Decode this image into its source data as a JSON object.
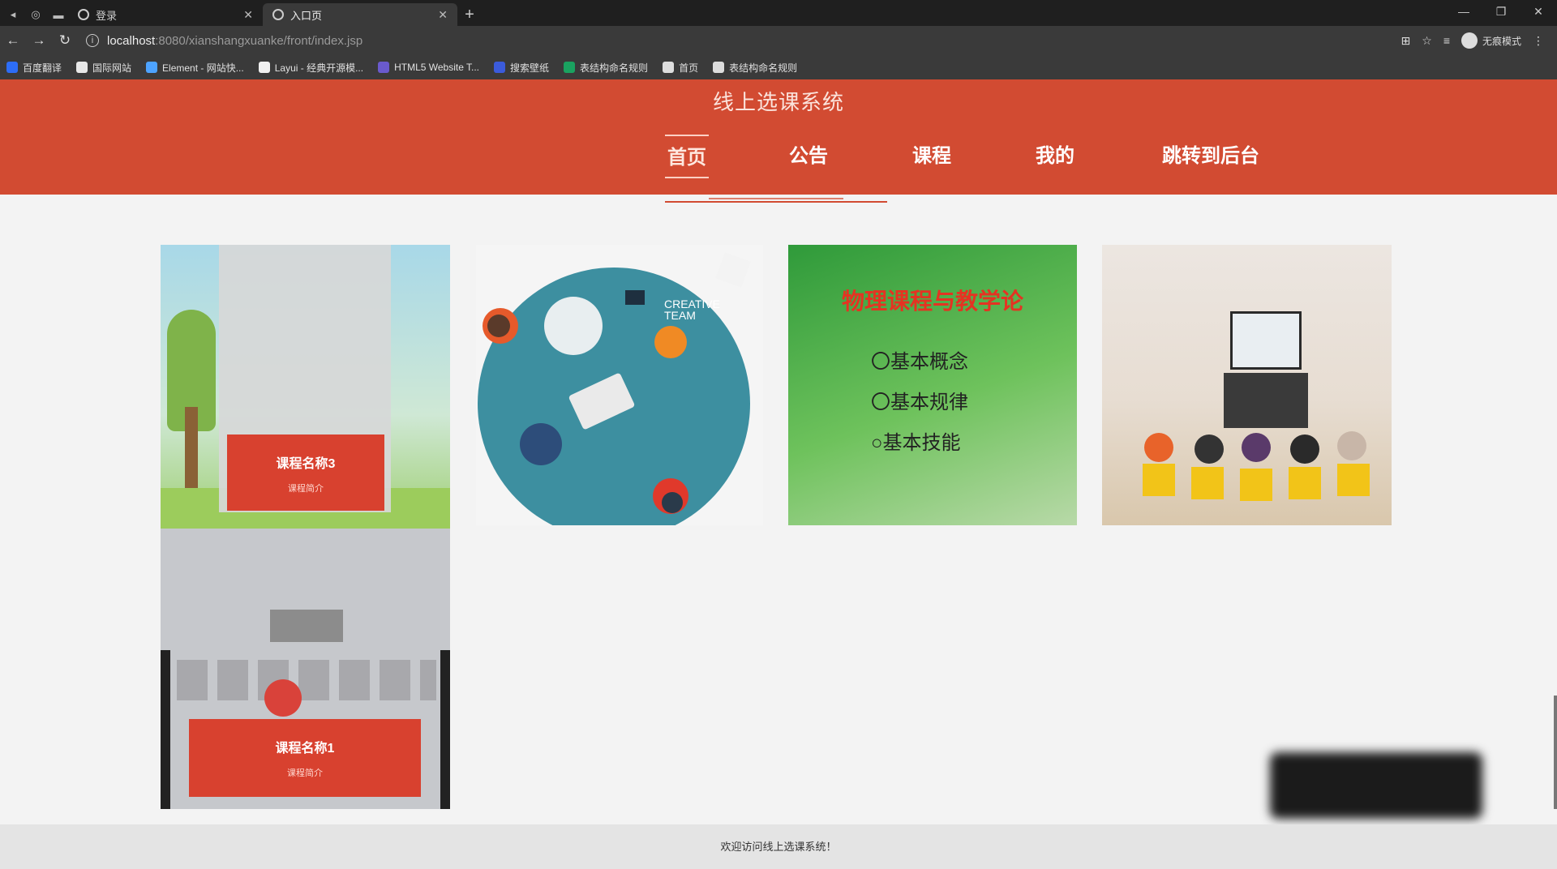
{
  "browser": {
    "tabs": [
      {
        "title": "登录"
      },
      {
        "title": "入口页"
      }
    ],
    "url_host": "localhost",
    "url_path": ":8080/xianshangxuanke/front/index.jsp",
    "profile_label": "无痕模式",
    "bookmarks": [
      {
        "label": "百度翻译",
        "color": "#2d6df6"
      },
      {
        "label": "国际网站",
        "color": "#e8e8e8"
      },
      {
        "label": "Element - 网站快...",
        "color": "#4da3ff"
      },
      {
        "label": "Layui - 经典开源模...",
        "color": "#f0f0f0"
      },
      {
        "label": "HTML5 Website T...",
        "color": "#6a5acd"
      },
      {
        "label": "搜索壁纸",
        "color": "#3b5bdb"
      },
      {
        "label": "表结构命名规则",
        "color": "#1aa260"
      },
      {
        "label": "首页",
        "color": "#ddd"
      },
      {
        "label": "表结构命名规则",
        "color": "#ddd"
      }
    ]
  },
  "site": {
    "title": "线上选课系统",
    "menu": [
      {
        "label": "首页",
        "active": true
      },
      {
        "label": "公告",
        "active": false
      },
      {
        "label": "课程",
        "active": false
      },
      {
        "label": "我的",
        "active": false
      },
      {
        "label": "跳转到后台",
        "active": false
      }
    ]
  },
  "cards": {
    "card1_top": {
      "name": "课程名称3",
      "sub": "课程简介"
    },
    "card1_bottom": {
      "name": "课程名称1",
      "sub": "课程简介"
    },
    "card2": {
      "title": "CREATIVE",
      "title2": "TEAM"
    },
    "card3": {
      "title": "物理课程与教学论",
      "items": [
        "〇基本概念",
        "〇基本规律",
        "○基本技能"
      ]
    }
  },
  "footer": {
    "text": "欢迎访问线上选课系统！"
  },
  "colors": {
    "header": "#d24b32",
    "accent_red": "#d8412f"
  }
}
